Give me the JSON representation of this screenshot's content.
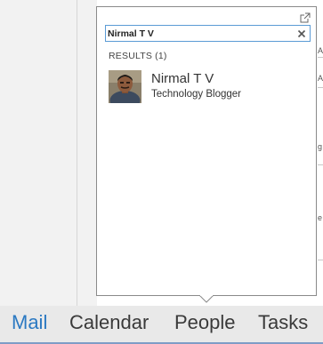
{
  "search": {
    "value": "Nirmal T V"
  },
  "results": {
    "label": "RESULTS (1)",
    "items": [
      {
        "name": "Nirmal T V",
        "subtitle": "Technology Blogger"
      }
    ]
  },
  "background": {
    "right_marks": [
      "A",
      "A",
      "g",
      "e"
    ]
  },
  "nav": {
    "items": [
      {
        "label": "Mail",
        "active": true
      },
      {
        "label": "Calendar",
        "active": false
      },
      {
        "label": "People",
        "active": false
      },
      {
        "label": "Tasks",
        "active": false
      }
    ]
  },
  "colors": {
    "accent": "#2b79c2",
    "search_border": "#5b9bd5",
    "nav_background": "#e9e9e9",
    "popup_border": "#8a8a8a"
  }
}
